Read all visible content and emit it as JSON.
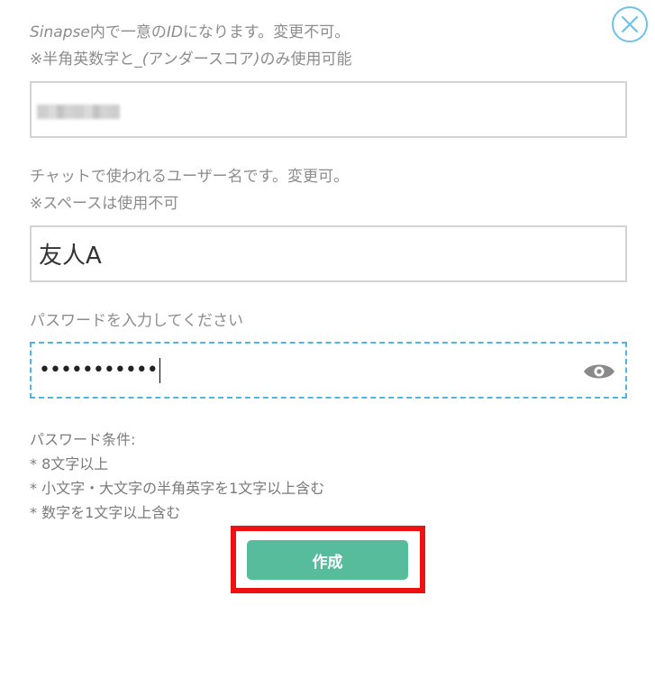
{
  "close": {
    "icon": "close-icon",
    "color": "#6ec2e8"
  },
  "user_id": {
    "hint_line1_prefix": "Sinapse",
    "hint_line1_mid": "内で一意の",
    "hint_line1_id": "ID",
    "hint_line1_suffix": "になります。変更不可。",
    "hint_line2_a": "※半角英数字と",
    "hint_line2_b": "_(",
    "hint_line2_c": "アンダースコア",
    "hint_line2_d": ")",
    "hint_line2_e": "のみ使用可能"
  },
  "display_name": {
    "hint_line1": "チャットで使われるユーザー名です。変更可。",
    "hint_line2": "※スペースは使用不可",
    "value": "友人A"
  },
  "password": {
    "label": "パスワードを入力してください",
    "masked_value": "•••••••••••",
    "toggle_icon": "eye-icon",
    "focus_color": "#4fb6e3"
  },
  "conditions": {
    "title": "パスワード条件:",
    "items": [
      "* 8文字以上",
      "* 小文字・大文字の半角英字を1文字以上含む",
      "* 数字を1文字以上含む"
    ]
  },
  "submit": {
    "label": "作成",
    "color": "#56bc9c",
    "highlight_color": "#ee1111"
  }
}
